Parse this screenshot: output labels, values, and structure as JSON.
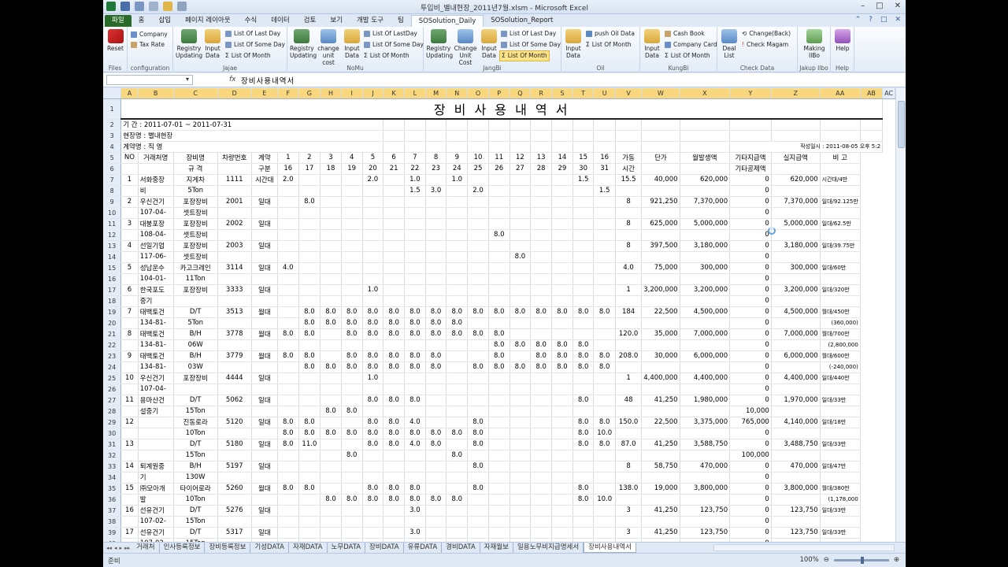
{
  "window": {
    "title": "투입비_별내현장_2011년7월.xlsm - Microsoft Excel",
    "min_glyph": "–",
    "max_glyph": "□",
    "close_glyph": "✕"
  },
  "tabs": [
    "파일",
    "홈",
    "삽입",
    "페이지 레이아웃",
    "수식",
    "데이터",
    "검토",
    "보기",
    "개발 도구",
    "팀",
    "SOSolution_Daily",
    "SOSolution_Report"
  ],
  "ribbon": {
    "files": {
      "reset": "Reset",
      "label": "Files"
    },
    "configuration": {
      "company": "Company",
      "tax_rate": "Tax Rate",
      "label": "configuration"
    },
    "jajae": {
      "registry": "Registry Updating",
      "input": "Input Data",
      "list_last": "List Of Last Day",
      "list_some": "List Of Some Day",
      "list_month": "List Of Month",
      "label": "Jajae"
    },
    "nomu": {
      "registry": "Registry Updating",
      "change": "change unit cost",
      "input": "Input Data",
      "list_last": "List Of LastDay",
      "list_some": "List Of Some Day",
      "list_month": "List Of Month",
      "label": "NoMu"
    },
    "jangbi": {
      "registry": "Registry Updating",
      "change": "Change Unit Cost",
      "input": "Input Data",
      "list_last": "List Of Last Day",
      "list_some": "List Of Some Day",
      "list_month": "List Of Month",
      "label": "JangBi"
    },
    "oil": {
      "input": "Input Data",
      "push": "push Oil Data",
      "list_month": "List Of Month",
      "label": "Oil"
    },
    "kungbi": {
      "input": "Input Data",
      "cash": "Cash Book",
      "company_card": "Company Card",
      "list_month": "List Of Month",
      "label": "KungBi"
    },
    "check": {
      "deal": "Deal List",
      "change": "Change(Back)",
      "check_magam": "Check Magam",
      "label": "Check Data"
    },
    "jakup": {
      "making": "Making IlBo",
      "label": "Jakup Ilbo"
    },
    "help": {
      "help": "Help",
      "label": "Help"
    }
  },
  "formula_bar": {
    "fx": "fx",
    "value": "장비사용내역서"
  },
  "columns": [
    "",
    "A",
    "B",
    "C",
    "D",
    "E",
    "F",
    "G",
    "H",
    "I",
    "J",
    "K",
    "L",
    "M",
    "N",
    "O",
    "P",
    "Q",
    "R",
    "S",
    "T",
    "U",
    "V",
    "W",
    "X",
    "Y",
    "Z",
    "AA",
    "AB",
    "AC"
  ],
  "sheet": {
    "title": "장 비 사 용 내 역 서",
    "period": "기  간 : 2011-07-01 ~ 2011-07-31",
    "site": "현장명 : 별내현장",
    "contract": "계약명 : 직  영",
    "printed": "작성일시 : 2011-08-05 오후 5:2",
    "headers": {
      "no": "NO",
      "vendor": "거래처명",
      "equip": "장비명",
      "spec": "규  격",
      "carno": "차량번호",
      "ctype1": "계약",
      "ctype2": "구분",
      "hours1": "가동",
      "hours2": "시간",
      "unit": "단가",
      "amount": "월발생액",
      "extra1": "기타지급액",
      "extra2": "기타공제액",
      "paid": "실지급액",
      "note": "비  고"
    },
    "days_top": [
      "1",
      "2",
      "3",
      "4",
      "5",
      "6",
      "7",
      "8",
      "9",
      "10",
      "11",
      "12",
      "13",
      "14",
      "15",
      "16"
    ],
    "days_bottom": [
      "16",
      "17",
      "18",
      "19",
      "20",
      "21",
      "22",
      "23",
      "24",
      "25",
      "26",
      "27",
      "28",
      "29",
      "30",
      "31"
    ],
    "rows": [
      {
        "no": "1",
        "v1": "서화중장",
        "v2": "비",
        "e1": "지게차",
        "e2": "5Ton",
        "car": "1111",
        "ct": "시간대",
        "top": {
          "0": "2.0",
          "4": "2.0",
          "6": "1.0",
          "8": "1.0",
          "14": "1.5"
        },
        "bot": {
          "6": "1.5",
          "7": "3.0",
          "9": "2.0",
          "15": "1.5"
        },
        "hrs": "15.5",
        "unit": "40,000",
        "amt": "620,000",
        "x1": "0",
        "x2": "0",
        "paid": "620,000",
        "note": "시간대/4만"
      },
      {
        "no": "2",
        "v1": "우신건기",
        "v2": "107-04-",
        "e1": "포장장비",
        "e2": "셋트장비",
        "car": "2001",
        "ct": "일대",
        "top": {
          "1": "8.0"
        },
        "bot": {},
        "hrs": "8",
        "unit": "921,250",
        "amt": "7,370,000",
        "x1": "0",
        "x2": "0",
        "paid": "7,370,000",
        "note": "일대/92.125만"
      },
      {
        "no": "3",
        "v1": "대붕포장",
        "v2": "108-04-",
        "e1": "포장장비",
        "e2": "셋트장비",
        "car": "2002",
        "ct": "일대",
        "top": {},
        "bot": {
          "10": "8.0"
        },
        "hrs": "8",
        "unit": "625,000",
        "amt": "5,000,000",
        "x1": "0",
        "x2": "0",
        "paid": "5,000,000",
        "note": "일대/62.5만"
      },
      {
        "no": "4",
        "v1": "선일기업",
        "v2": "117-06-",
        "e1": "포장장비",
        "e2": "셋트장비",
        "car": "2003",
        "ct": "일대",
        "top": {},
        "bot": {
          "11": "8.0"
        },
        "hrs": "8",
        "unit": "397,500",
        "amt": "3,180,000",
        "x1": "0",
        "x2": "0",
        "paid": "3,180,000",
        "note": "일대/39.75만"
      },
      {
        "no": "5",
        "v1": "성남운수",
        "v2": "104-01-",
        "e1": "카고크레인",
        "e2": "11Ton",
        "car": "3114",
        "ct": "일대",
        "top": {
          "0": "4.0"
        },
        "bot": {},
        "hrs": "4.0",
        "unit": "75,000",
        "amt": "300,000",
        "x1": "0",
        "x2": "0",
        "paid": "300,000",
        "note": "일대/60만"
      },
      {
        "no": "6",
        "v1": "한국포도",
        "v2": "중기",
        "e1": "포장장비",
        "e2": "",
        "car": "3333",
        "ct": "일대",
        "top": {
          "4": "1.0"
        },
        "bot": {},
        "hrs": "1",
        "unit": "3,200,000",
        "amt": "3,200,000",
        "x1": "0",
        "x2": "0",
        "paid": "3,200,000",
        "note": "일대/320만"
      },
      {
        "no": "7",
        "v1": "태백토건",
        "v2": "134-81-",
        "e1": "D/T",
        "e2": "5Ton",
        "car": "3513",
        "ct": "월대",
        "top": {
          "1": "8.0",
          "2": "8.0",
          "3": "8.0",
          "4": "8.0",
          "5": "8.0",
          "6": "8.0",
          "7": "8.0",
          "8": "8.0",
          "9": "8.0",
          "10": "8.0",
          "11": "8.0",
          "12": "8.0",
          "13": "8.0",
          "14": "8.0",
          "15": "8.0"
        },
        "bot": {
          "1": "8.0",
          "2": "8.0",
          "3": "8.0",
          "4": "8.0",
          "5": "8.0",
          "6": "8.0",
          "7": "8.0",
          "8": "8.0"
        },
        "hrs": "184",
        "unit": "22,500",
        "amt": "4,500,000",
        "x1": "0",
        "x2": "0",
        "paid": "4,500,000",
        "note": "월대/450만",
        "note2": "(360,000)"
      },
      {
        "no": "8",
        "v1": "태백토건",
        "v2": "134-81-",
        "e1": "B/H",
        "e2": "06W",
        "car": "3778",
        "ct": "월대",
        "top": {
          "0": "8.0",
          "1": "8.0",
          "3": "8.0",
          "4": "8.0",
          "5": "8.0",
          "6": "8.0",
          "7": "8.0",
          "8": "8.0",
          "9": "8.0",
          "10": "8.0"
        },
        "bot": {
          "10": "8.0",
          "11": "8.0",
          "12": "8.0",
          "13": "8.0",
          "14": "8.0"
        },
        "hrs": "120.0",
        "unit": "35,000",
        "amt": "7,000,000",
        "x1": "0",
        "x2": "0",
        "paid": "7,000,000",
        "note": "월대/700만",
        "note2": "(2,800,000"
      },
      {
        "no": "9",
        "v1": "태백토건",
        "v2": "134-81-",
        "e1": "B/H",
        "e2": "03W",
        "car": "3779",
        "ct": "월대",
        "top": {
          "0": "8.0",
          "1": "8.0",
          "3": "8.0",
          "4": "8.0",
          "5": "8.0",
          "6": "8.0",
          "7": "8.0",
          "10": "8.0",
          "12": "8.0",
          "13": "8.0",
          "14": "8.0",
          "15": "8.0"
        },
        "bot": {
          "1": "8.0",
          "2": "8.0",
          "3": "8.0",
          "4": "8.0",
          "5": "8.0",
          "6": "8.0",
          "7": "8.0",
          "9": "8.0",
          "10": "8.0",
          "11": "8.0",
          "12": "8.0",
          "13": "8.0",
          "14": "8.0",
          "15": "8.0"
        },
        "hrs": "208.0",
        "unit": "30,000",
        "amt": "6,000,000",
        "x1": "0",
        "x2": "0",
        "paid": "6,000,000",
        "note": "월대/600만",
        "note2": "(-240,000)"
      },
      {
        "no": "10",
        "v1": "우신건기",
        "v2": "107-04-",
        "e1": "포장장비",
        "e2": "",
        "car": "4444",
        "ct": "일대",
        "top": {
          "4": "1.0"
        },
        "bot": {},
        "hrs": "1",
        "unit": "4,400,000",
        "amt": "4,400,000",
        "x1": "0",
        "x2": "0",
        "paid": "4,400,000",
        "note": "일대/440만"
      },
      {
        "no": "11",
        "v1": "용마산건",
        "v2": "설중기",
        "e1": "D/T",
        "e2": "15Ton",
        "car": "5062",
        "ct": "일대",
        "top": {
          "4": "8.0",
          "5": "8.0",
          "6": "8.0",
          "14": "8.0"
        },
        "bot": {
          "2": "8.0",
          "3": "8.0"
        },
        "hrs": "48",
        "unit": "41,250",
        "amt": "1,980,000",
        "x1": "0",
        "x2": "10,000",
        "paid": "1,970,000",
        "note": "일대/33만"
      },
      {
        "no": "12",
        "v1": "",
        "v2": "",
        "e1": "진동로라",
        "e2": "10Ton",
        "car": "5120",
        "ct": "일대",
        "top": {
          "0": "8.0",
          "1": "8.0",
          "4": "8.0",
          "5": "8.0",
          "6": "4.0",
          "9": "8.0",
          "14": "8.0",
          "15": "8.0"
        },
        "bot": {
          "0": "8.0",
          "1": "8.0",
          "2": "8.0",
          "3": "8.0",
          "4": "8.0",
          "5": "8.0",
          "6": "8.0",
          "7": "8.0",
          "8": "8.0",
          "9": "8.0",
          "14": "8.0",
          "15": "10.0"
        },
        "hrs": "150.0",
        "unit": "22,500",
        "amt": "3,375,000",
        "x1": "765,000",
        "x2": "0",
        "paid": "4,140,000",
        "note": "일대/18만"
      },
      {
        "no": "13",
        "v1": "",
        "v2": "",
        "e1": "D/T",
        "e2": "15Ton",
        "car": "5180",
        "ct": "일대",
        "top": {
          "0": "8.0",
          "1": "11.0",
          "4": "8.0",
          "5": "8.0",
          "6": "4.0",
          "7": "8.0",
          "9": "8.0",
          "14": "8.0",
          "15": "8.0"
        },
        "bot": {
          "3": "8.0",
          "8": "8.0"
        },
        "hrs": "87.0",
        "unit": "41,250",
        "amt": "3,588,750",
        "x1": "0",
        "x2": "100,000",
        "paid": "3,488,750",
        "note": "일대/33만"
      },
      {
        "no": "14",
        "v1": "퇴계원중",
        "v2": "기",
        "e1": "B/H",
        "e2": "130W",
        "car": "5197",
        "ct": "일대",
        "top": {
          "9": "8.0"
        },
        "bot": {},
        "hrs": "8",
        "unit": "58,750",
        "amt": "470,000",
        "x1": "0",
        "x2": "0",
        "paid": "470,000",
        "note": "일대/47만"
      },
      {
        "no": "15",
        "v1": "㈜모아개",
        "v2": "발",
        "e1": "타이어로라",
        "e2": "10Ton",
        "car": "5260",
        "ct": "월대",
        "top": {
          "0": "8.0",
          "1": "8.0",
          "4": "8.0",
          "5": "8.0",
          "6": "8.0",
          "9": "8.0",
          "14": "8.0"
        },
        "bot": {
          "2": "8.0",
          "3": "8.0",
          "4": "8.0",
          "5": "8.0",
          "6": "8.0",
          "7": "8.0",
          "8": "8.0",
          "14": "8.0",
          "15": "10.0"
        },
        "hrs": "138.0",
        "unit": "19,000",
        "amt": "3,800,000",
        "x1": "0",
        "x2": "0",
        "paid": "3,800,000",
        "note": "월대/380만",
        "note2": "(1,178,000"
      },
      {
        "no": "16",
        "v1": "선유건기",
        "v2": "107-02-",
        "e1": "D/T",
        "e2": "15Ton",
        "car": "5276",
        "ct": "일대",
        "top": {
          "6": "3.0"
        },
        "bot": {},
        "hrs": "3",
        "unit": "41,250",
        "amt": "123,750",
        "x1": "0",
        "x2": "0",
        "paid": "123,750",
        "note": "일대/33만"
      },
      {
        "no": "17",
        "v1": "선유건기",
        "v2": "107-02-",
        "e1": "D/T",
        "e2": "15Ton",
        "car": "5317",
        "ct": "일대",
        "top": {
          "6": "3.0"
        },
        "bot": {},
        "hrs": "3",
        "unit": "41,250",
        "amt": "123,750",
        "x1": "0",
        "x2": "0",
        "paid": "123,750",
        "note": "일대/33만"
      }
    ]
  },
  "sheet_tabs": [
    "거래처",
    "인사등록정보",
    "장비등록정보",
    "기성DATA",
    "자재DATA",
    "노무DATA",
    "장비DATA",
    "유류DATA",
    "경비DATA",
    "자재월보",
    "일용노무비지급명세서",
    "장비사용내역서"
  ],
  "status": {
    "ready": "준비",
    "zoom": "100%",
    "minus": "⊖",
    "plus": "⊕"
  }
}
